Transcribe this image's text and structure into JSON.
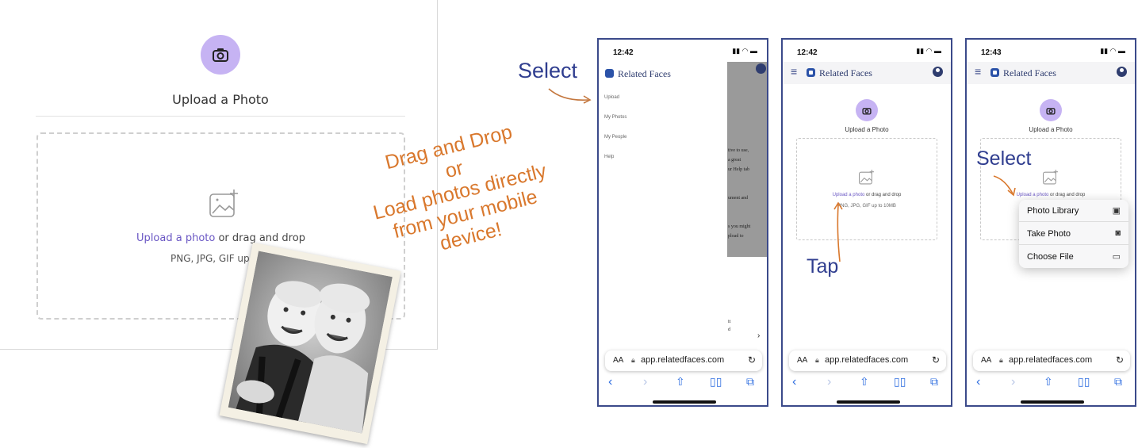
{
  "desktop": {
    "title": "Upload a Photo",
    "upload_link": "Upload a photo",
    "upload_rest": " or drag and drop",
    "file_hint": "PNG, JPG, GIF up to 1"
  },
  "annotations": {
    "select_1": "Select",
    "drag_lines": [
      "Drag and Drop",
      "or",
      "Load photos directly",
      "from your mobile",
      "device!"
    ],
    "tap": "Tap",
    "select_3": "Select"
  },
  "phone1": {
    "time": "12:42",
    "brand": "Related Faces",
    "menu": [
      "Upload",
      "My Photos",
      "My People",
      "Help"
    ],
    "overlay_text": [
      "tive to use,",
      "a great",
      "ur Help tab",
      "ument and",
      "s you might",
      "pload to",
      "it",
      "d"
    ],
    "url": "app.relatedfaces.com"
  },
  "phone2": {
    "time": "12:42",
    "brand": "Related Faces",
    "title": "Upload a Photo",
    "upload_link": "Upload a photo",
    "upload_rest": " or drag and drop",
    "file_hint": "PNG, JPG, GIF up to 10MB",
    "url": "app.relatedfaces.com"
  },
  "phone3": {
    "time": "12:43",
    "brand": "Related Faces",
    "title": "Upload a Photo",
    "upload_link": "Upload a photo",
    "upload_rest": " or drag and drop",
    "url": "app.relatedfaces.com",
    "sheet": [
      "Photo Library",
      "Take Photo",
      "Choose File"
    ]
  },
  "browser": {
    "aa": "AA",
    "reload": "↻"
  },
  "colors": {
    "accent": "#6a57c4",
    "camera_bg": "#c6b3f3",
    "annotation_blue": "#2f3d8f",
    "annotation_orange": "#d9782d",
    "phone_border": "#3b4a8a"
  }
}
